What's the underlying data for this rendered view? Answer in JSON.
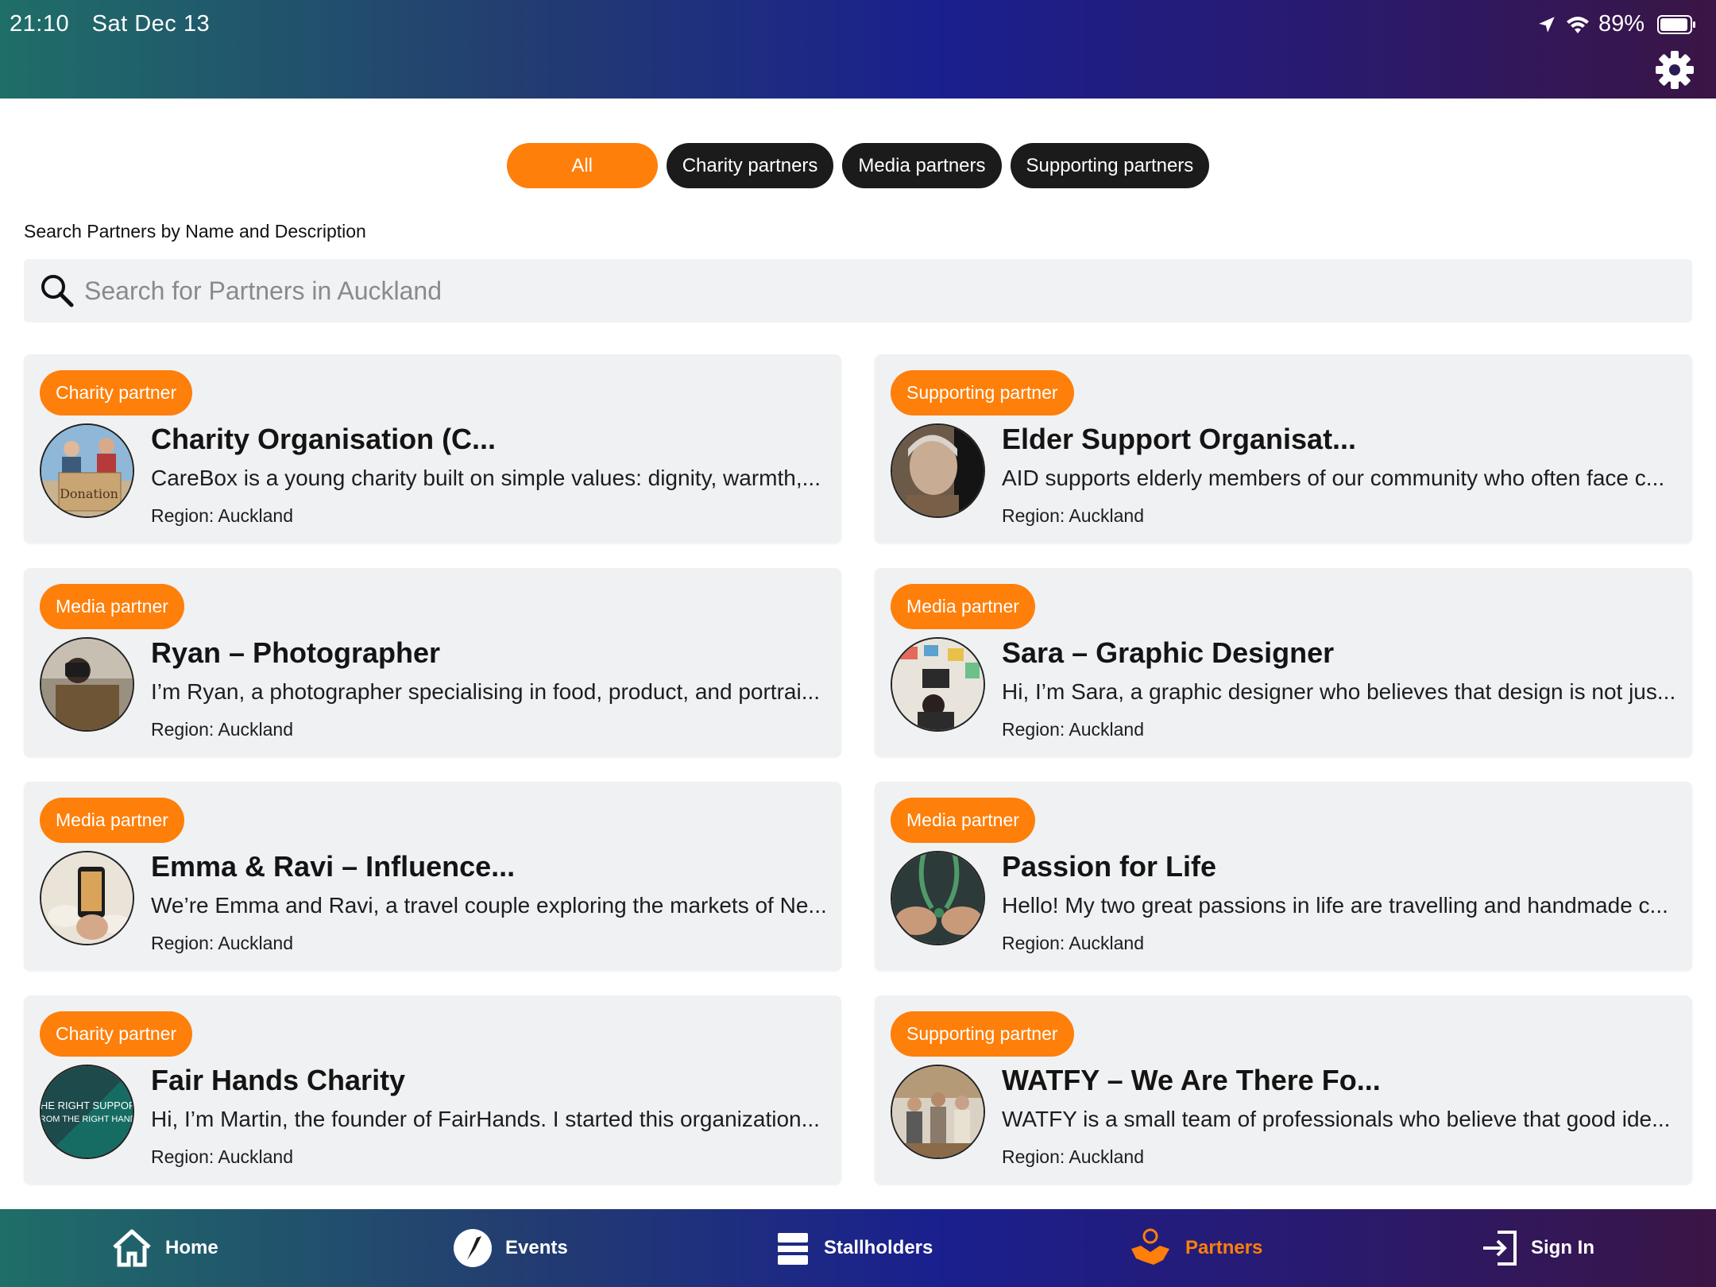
{
  "status_bar": {
    "time": "21:10",
    "date": "Sat Dec 13",
    "battery": "89%",
    "battery_level": 0.89
  },
  "filters": [
    {
      "label": "All",
      "active": true
    },
    {
      "label": "Charity partners",
      "active": false
    },
    {
      "label": "Media partners",
      "active": false
    },
    {
      "label": "Supporting partners",
      "active": false
    }
  ],
  "search": {
    "label": "Search Partners by Name and Description",
    "placeholder": "Search for Partners in Auckland"
  },
  "cards": [
    {
      "badge": "Charity partner",
      "title": "Charity Organisation (C...",
      "description": "CareBox is a young charity built on simple values: dignity, warmth,...",
      "region": "Region: Auckland"
    },
    {
      "badge": "Supporting partner",
      "title": "Elder Support Organisat...",
      "description": "AID supports elderly members of our community who often face c...",
      "region": "Region: Auckland"
    },
    {
      "badge": "Media partner",
      "title": "Ryan – Photographer",
      "description": "I’m Ryan, a photographer specialising in food, product, and portrai...",
      "region": "Region: Auckland"
    },
    {
      "badge": "Media partner",
      "title": "Sara – Graphic Designer",
      "description": "Hi, I’m Sara, a graphic designer who believes that design is not jus...",
      "region": "Region: Auckland"
    },
    {
      "badge": "Media partner",
      "title": "Emma & Ravi – Influence...",
      "description": "We’re Emma and Ravi, a travel couple exploring the markets of Ne...",
      "region": "Region: Auckland"
    },
    {
      "badge": "Media partner",
      "title": "Passion for Life",
      "description": "Hello! My two great passions in life are travelling and handmade c...",
      "region": "Region: Auckland"
    },
    {
      "badge": "Charity partner",
      "title": "Fair Hands Charity",
      "description": "Hi, I’m Martin, the founder of FairHands. I started this organization...",
      "region": "Region: Auckland"
    },
    {
      "badge": "Supporting partner",
      "title": "WATFY – We Are There Fo...",
      "description": "WATFY is a small team of professionals who believe that good ide...",
      "region": "Region: Auckland"
    }
  ],
  "avatar_texts": {
    "charity": "Donation",
    "fairhands_line1": "THE RIGHT SUPPORT",
    "fairhands_line2": "FROM THE RIGHT HANDS"
  },
  "nav": {
    "home": "Home",
    "events": "Events",
    "stallholders": "Stallholders",
    "partners": "Partners",
    "signin": "Sign In"
  },
  "colors": {
    "accent": "#fe7f0a",
    "pill_dark": "#1b1b1b",
    "card_bg": "#f0f1f3"
  }
}
